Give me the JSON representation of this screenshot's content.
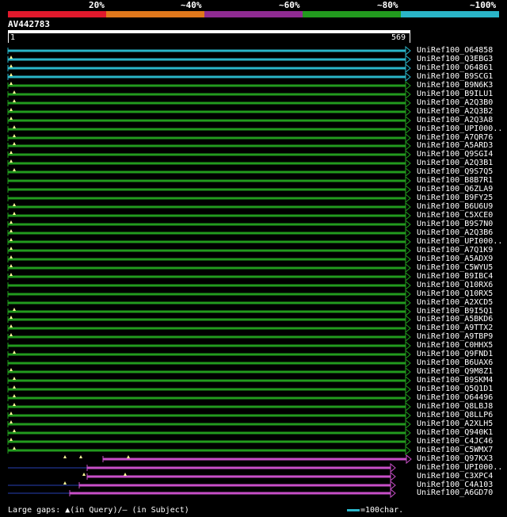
{
  "legend": {
    "labels": [
      "20%",
      "~40%",
      "~60%",
      "~80%",
      "~100%"
    ],
    "colors": [
      "#e0192c",
      "#e0781c",
      "#8f2b92",
      "#229a1e",
      "#2ab5c8"
    ]
  },
  "query": {
    "name": "AV442783",
    "start": "1",
    "end": "569"
  },
  "colors": {
    "cyan": "#2ab5c8",
    "green": "#229a1e",
    "magenta": "#c84fc8",
    "navy": "#14205a",
    "marker": "#ffff99"
  },
  "hits": [
    {
      "label": "UniRef100_O64858",
      "identity": "~100%",
      "markers": []
    },
    {
      "label": "UniRef100_Q3EBG3",
      "identity": "~100%",
      "markers": [
        1
      ]
    },
    {
      "label": "UniRef100_O64861",
      "identity": "~100%",
      "markers": [
        1
      ]
    },
    {
      "label": "UniRef100_B9SCG1",
      "identity": "~100%",
      "markers": [
        1
      ]
    },
    {
      "label": "UniRef100_B9N6K3",
      "identity": "~80%",
      "markers": [
        1
      ]
    },
    {
      "label": "UniRef100_B9ILU1",
      "identity": "~80%",
      "markers": [
        2
      ]
    },
    {
      "label": "UniRef100_A2Q3B0",
      "identity": "~80%",
      "markers": [
        2
      ]
    },
    {
      "label": "UniRef100_A2Q3B2",
      "identity": "~80%",
      "markers": [
        1
      ]
    },
    {
      "label": "UniRef100_A2Q3A8",
      "identity": "~80%",
      "markers": [
        1
      ]
    },
    {
      "label": "UniRef100_UPI000..",
      "identity": "~80%",
      "markers": [
        2
      ]
    },
    {
      "label": "UniRef100_A7QR76",
      "identity": "~80%",
      "markers": [
        2
      ]
    },
    {
      "label": "UniRef100_A5ARD3",
      "identity": "~80%",
      "markers": [
        2
      ]
    },
    {
      "label": "UniRef100_Q9SGI4",
      "identity": "~80%",
      "markers": [
        1
      ]
    },
    {
      "label": "UniRef100_A2Q3B1",
      "identity": "~80%",
      "markers": [
        1
      ]
    },
    {
      "label": "UniRef100_Q9S7Q5",
      "identity": "~80%",
      "markers": [
        2
      ]
    },
    {
      "label": "UniRef100_B8B7R1",
      "identity": "~80%",
      "markers": []
    },
    {
      "label": "UniRef100_Q6ZLA9",
      "identity": "~80%",
      "markers": []
    },
    {
      "label": "UniRef100_B9FY25",
      "identity": "~80%",
      "markers": []
    },
    {
      "label": "UniRef100_B6U6U9",
      "identity": "~80%",
      "markers": [
        2
      ]
    },
    {
      "label": "UniRef100_C5XCE0",
      "identity": "~80%",
      "markers": [
        2
      ]
    },
    {
      "label": "UniRef100_B9S7N0",
      "identity": "~80%",
      "markers": [
        1
      ]
    },
    {
      "label": "UniRef100_A2Q3B6",
      "identity": "~80%",
      "markers": [
        1
      ]
    },
    {
      "label": "UniRef100_UPI000..",
      "identity": "~80%",
      "markers": [
        1
      ]
    },
    {
      "label": "UniRef100_A7Q1K9",
      "identity": "~80%",
      "markers": [
        1
      ]
    },
    {
      "label": "UniRef100_A5ADX9",
      "identity": "~80%",
      "markers": [
        1
      ]
    },
    {
      "label": "UniRef100_C5WYU5",
      "identity": "~80%",
      "markers": [
        1
      ]
    },
    {
      "label": "UniRef100_B9IBC4",
      "identity": "~80%",
      "markers": [
        1
      ]
    },
    {
      "label": "UniRef100_Q10RX6",
      "identity": "~80%",
      "markers": []
    },
    {
      "label": "UniRef100_Q10RX5",
      "identity": "~80%",
      "markers": []
    },
    {
      "label": "UniRef100_A2XCD5",
      "identity": "~80%",
      "markers": []
    },
    {
      "label": "UniRef100_B9I5Q1",
      "identity": "~80%",
      "markers": [
        2
      ]
    },
    {
      "label": "UniRef100_A5BKD6",
      "identity": "~80%",
      "markers": [
        1
      ]
    },
    {
      "label": "UniRef100_A9TTX2",
      "identity": "~80%",
      "markers": [
        1
      ]
    },
    {
      "label": "UniRef100_A9TBP9",
      "identity": "~80%",
      "markers": [
        1
      ]
    },
    {
      "label": "UniRef100_C0HHX5",
      "identity": "~80%",
      "markers": []
    },
    {
      "label": "UniRef100_Q9FND1",
      "identity": "~80%",
      "markers": [
        2
      ]
    },
    {
      "label": "UniRef100_B6UAX6",
      "identity": "~80%",
      "markers": []
    },
    {
      "label": "UniRef100_Q9M8Z1",
      "identity": "~80%",
      "markers": [
        1
      ]
    },
    {
      "label": "UniRef100_B9SKM4",
      "identity": "~80%",
      "markers": [
        2
      ]
    },
    {
      "label": "UniRef100_Q5Q1D1",
      "identity": "~80%",
      "markers": [
        2
      ]
    },
    {
      "label": "UniRef100_O64496",
      "identity": "~80%",
      "markers": [
        2
      ]
    },
    {
      "label": "UniRef100_Q8LBJ8",
      "identity": "~80%",
      "markers": [
        2
      ]
    },
    {
      "label": "UniRef100_Q8LLP6",
      "identity": "~80%",
      "markers": [
        1
      ]
    },
    {
      "label": "UniRef100_A2XLH5",
      "identity": "~80%",
      "markers": [
        1
      ]
    },
    {
      "label": "UniRef100_Q940K1",
      "identity": "~80%",
      "markers": [
        2
      ]
    },
    {
      "label": "UniRef100_C4JC46",
      "identity": "~80%",
      "markers": [
        1
      ]
    },
    {
      "label": "UniRef100_C5WMX7",
      "identity": "~80%",
      "markers": [
        2
      ]
    },
    {
      "label": "UniRef100_Q97KX3",
      "identity": "~60%",
      "markers": [
        18,
        23,
        38
      ]
    },
    {
      "label": "UniRef100_UPI000..",
      "identity": "~60%",
      "markers": []
    },
    {
      "label": "UniRef100_C3XPC4",
      "identity": "~60%",
      "markers": [
        24,
        37
      ]
    },
    {
      "label": "UniRef100_C4A103",
      "identity": "~60%",
      "markers": [
        18
      ]
    },
    {
      "label": "UniRef100_A6GD70",
      "identity": "~60%",
      "markers": []
    }
  ],
  "footer": {
    "large_gaps": "Large gaps: ▲(in Query)/— (in Subject)",
    "scale_label": "=100char."
  }
}
